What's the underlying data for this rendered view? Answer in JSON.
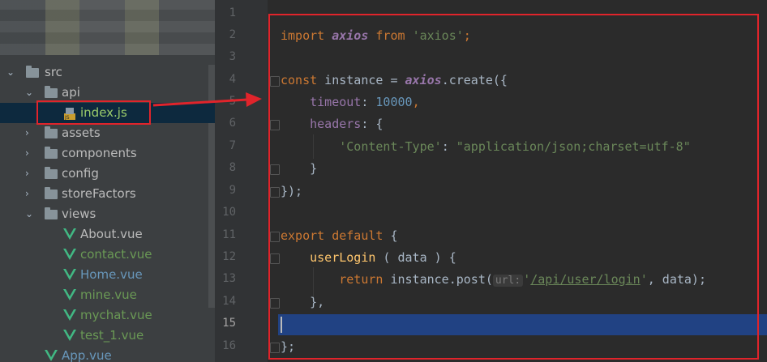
{
  "colors": {
    "annotation": "#e0242b",
    "selection": "#0d293e",
    "line_highlight": "#214283"
  },
  "project_tree": {
    "items": [
      {
        "name": "src",
        "type": "folder",
        "expanded": true
      },
      {
        "name": "api",
        "type": "folder",
        "expanded": true
      },
      {
        "name": "index.js",
        "type": "js-file",
        "selected": true
      },
      {
        "name": "assets",
        "type": "folder",
        "expanded": false
      },
      {
        "name": "components",
        "type": "folder",
        "expanded": false
      },
      {
        "name": "config",
        "type": "folder",
        "expanded": false
      },
      {
        "name": "storeFactors",
        "type": "folder",
        "expanded": false
      },
      {
        "name": "views",
        "type": "folder",
        "expanded": true
      },
      {
        "name": "About.vue",
        "type": "vue-file"
      },
      {
        "name": "contact.vue",
        "type": "vue-file"
      },
      {
        "name": "Home.vue",
        "type": "vue-file"
      },
      {
        "name": "mine.vue",
        "type": "vue-file"
      },
      {
        "name": "mychat.vue",
        "type": "vue-file"
      },
      {
        "name": "test_1.vue",
        "type": "vue-file"
      },
      {
        "name": "App.vue",
        "type": "vue-file"
      }
    ]
  },
  "editor": {
    "line_numbers": [
      "1",
      "2",
      "3",
      "4",
      "5",
      "6",
      "7",
      "8",
      "9",
      "10",
      "11",
      "12",
      "13",
      "14",
      "15",
      "16"
    ],
    "current_line": "15",
    "tokens": {
      "import": "import",
      "axios": "axios",
      "from": "from",
      "axios_str": "'axios'",
      "semi": ";",
      "const": "const",
      "instance_decl": " instance = ",
      "axios2": "axios",
      "create": ".create({",
      "timeout": "timeout",
      "colon_sp": ": ",
      "timeout_val": "10000",
      "comma": ",",
      "headers": "headers",
      "brace_open": ": {",
      "ct_key": "'Content-Type'",
      "ct_val": "\"application/json;charset=utf-8\"",
      "close_brace": "}",
      "close_create": "});",
      "export": "export",
      "default": "default",
      "open_brace": " {",
      "userLogin": "userLogin",
      "params": " ( data ) {",
      "return": "return",
      "instance_post": " instance.post(",
      "url_hint": "url:",
      "url_q1": "'",
      "url_path": "/api/user/login",
      "url_q2": "'",
      "post_tail": ", data);",
      "close_method": "},",
      "close_export": "};"
    }
  }
}
